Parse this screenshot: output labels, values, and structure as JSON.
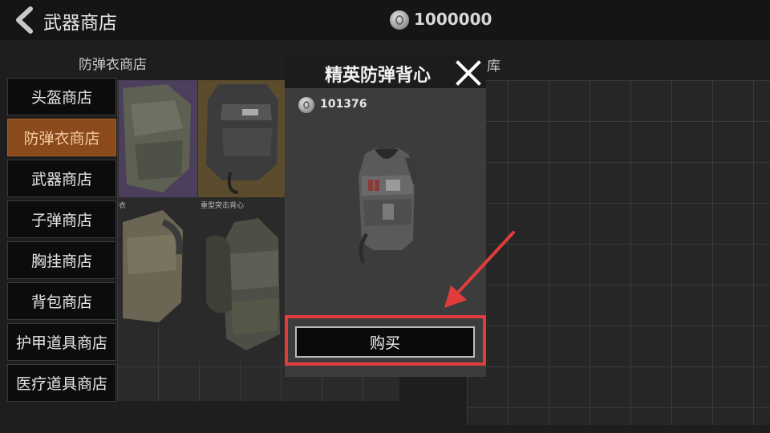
{
  "header": {
    "title": "武器商店",
    "back_icon": "chevron-left-icon",
    "currency_icon": "coin-icon",
    "money": "1000000"
  },
  "shop_section": {
    "subtitle": "防弹衣商店"
  },
  "storage_section": {
    "subtitle": "仓库"
  },
  "sidebar": {
    "items": [
      {
        "label": "头盔商店",
        "active": false
      },
      {
        "label": "防弹衣商店",
        "active": true
      },
      {
        "label": "武器商店",
        "active": false
      },
      {
        "label": "子弹商店",
        "active": false
      },
      {
        "label": "胸挂商店",
        "active": false
      },
      {
        "label": "背包商店",
        "active": false
      },
      {
        "label": "护甲道具商店",
        "active": false
      },
      {
        "label": "医疗道具商店",
        "active": false
      }
    ]
  },
  "shop_items": [
    {
      "label": ""
    },
    {
      "label": ""
    },
    {
      "label": "衣"
    },
    {
      "label": "重型突击背心"
    }
  ],
  "modal": {
    "title": "精英防弹背心",
    "close_icon": "close-icon",
    "price": "101376",
    "buy_label": "购买"
  },
  "colors": {
    "active_tab": "#8a4a1c",
    "highlight": "#e03c3c"
  }
}
